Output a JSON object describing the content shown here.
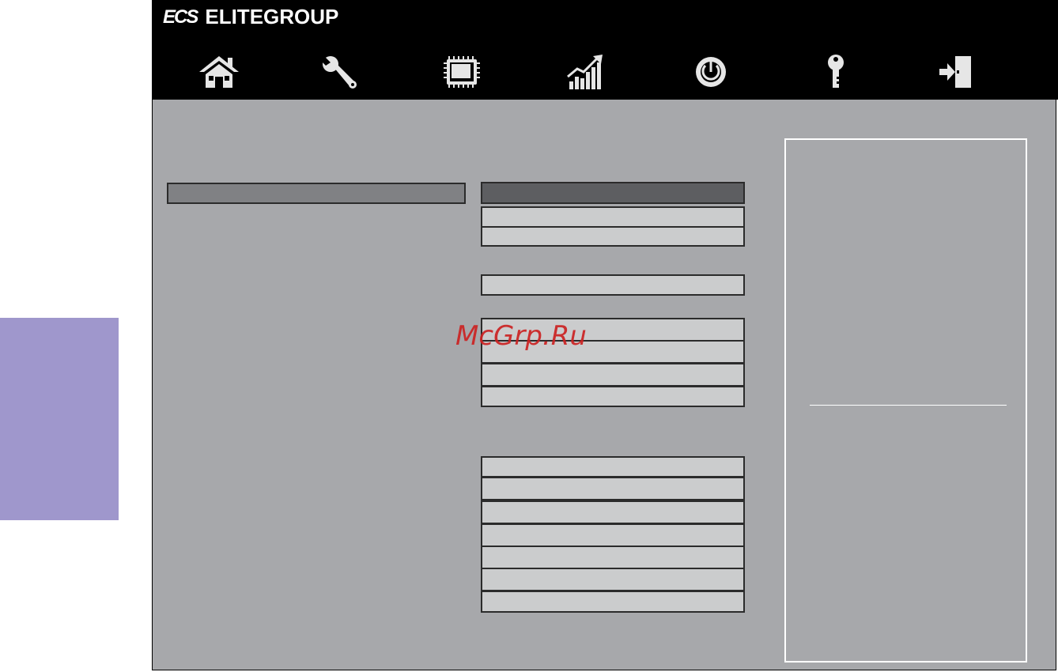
{
  "brand": {
    "logo_mark": "ECS",
    "name": "ELITEGROUP"
  },
  "toolbar": {
    "icons": [
      "home-icon",
      "wrench-icon",
      "chip-icon",
      "performance-chart-icon",
      "power-icon",
      "key-icon",
      "exit-icon"
    ]
  },
  "watermark": "McGrp.Ru",
  "colors": {
    "content_bg": "#a7a8ab",
    "field_bg": "#cbcccd",
    "field_selected_bg": "#5d5e61",
    "side_tab": "#9f97cc",
    "toolbar_bg": "#000000"
  }
}
